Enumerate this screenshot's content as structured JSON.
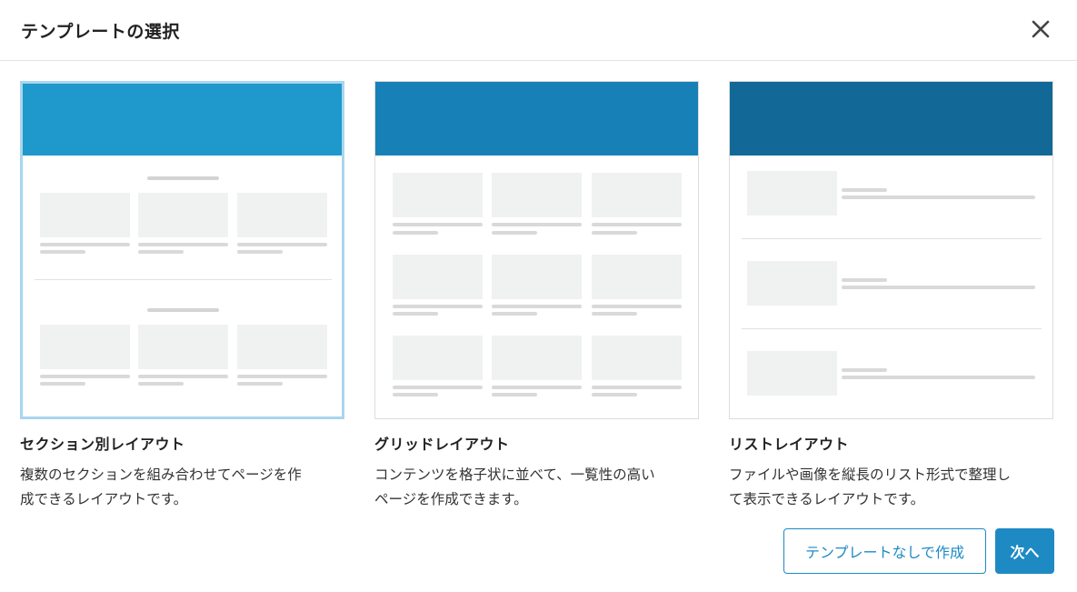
{
  "dialog": {
    "title": "テンプレートの選択"
  },
  "colors": {
    "hero_section": "#1f98cb",
    "hero_grid": "#1781b7",
    "hero_list": "#126896",
    "accent": "#1d8ac4",
    "selected_border": "#a9d6ee"
  },
  "icons": {
    "close": "close-icon"
  },
  "templates": [
    {
      "id": "section",
      "title": "セクション別レイアウト",
      "desc_line1": "複数のセクションを組み合わせてページを作",
      "desc_line2": "成できるレイアウトです。",
      "selected": true
    },
    {
      "id": "grid",
      "title": "グリッドレイアウト",
      "desc_line1": "コンテンツを格子状に並べて、一覧性の高い",
      "desc_line2": "ページを作成できます。",
      "selected": false
    },
    {
      "id": "list",
      "title": "リストレイアウト",
      "desc_line1": "ファイルや画像を縦長のリスト形式で整理し",
      "desc_line2": "て表示できるレイアウトです。",
      "selected": false
    }
  ],
  "footer": {
    "no_template_label": "テンプレートなしで作成",
    "next_label": "次へ"
  }
}
